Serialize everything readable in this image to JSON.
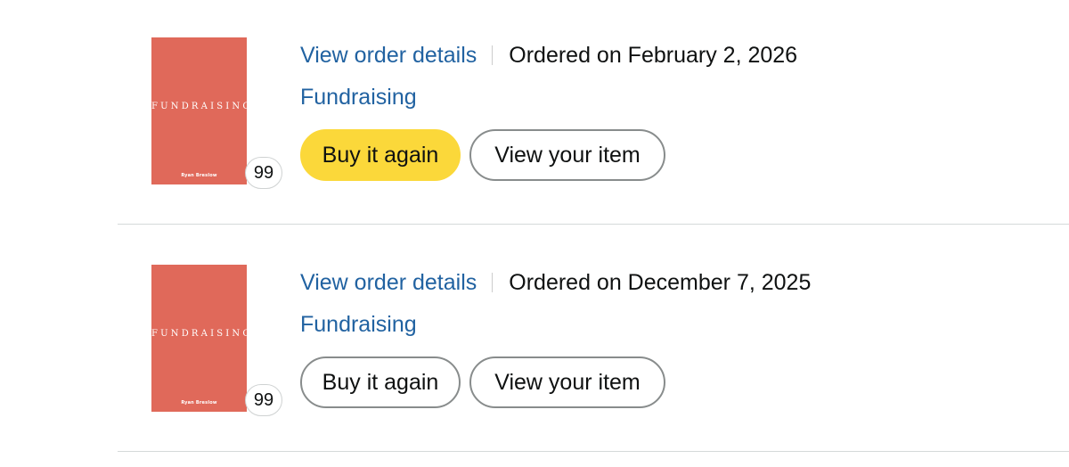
{
  "orders": [
    {
      "view_order_details": "View order details",
      "ordered_on": "Ordered on February 2, 2026",
      "product_title": "Fundraising",
      "cover": {
        "title": "FUNDRAISING",
        "author": "Ryan Breslow",
        "color": "#e0695a"
      },
      "quantity": "99",
      "buy_again_label": "Buy it again",
      "buy_again_style": "primary",
      "view_item_label": "View your item"
    },
    {
      "view_order_details": "View order details",
      "ordered_on": "Ordered on December 7, 2025",
      "product_title": "Fundraising",
      "cover": {
        "title": "FUNDRAISING",
        "author": "Ryan Breslow",
        "color": "#e0695a"
      },
      "quantity": "99",
      "buy_again_label": "Buy it again",
      "buy_again_style": "secondary",
      "view_item_label": "View your item"
    }
  ],
  "colors": {
    "link": "#2162a1",
    "primary_button": "#fbd83a",
    "text": "#0f1111",
    "separator": "#d5d9d9"
  }
}
